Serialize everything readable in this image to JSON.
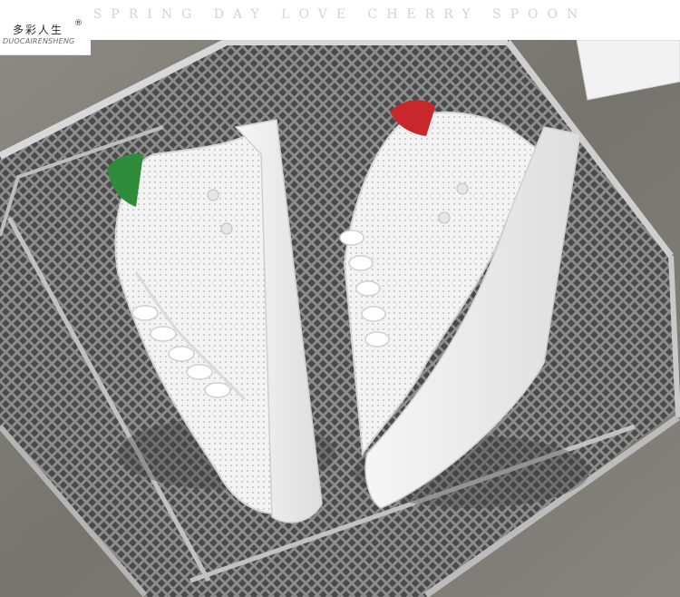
{
  "header": {
    "tagline": "SPRING DAY LOVE CHERRY SPOON"
  },
  "brand": {
    "name_cn": "多彩人生",
    "trademark": "®",
    "name_en": "DUOCAIRENSHENG"
  },
  "photo": {
    "subject": "pair of white perforated leather sneakers on a metal mesh basket",
    "heel_tab_colors": [
      "#2e8b3a",
      "#c8282c"
    ]
  }
}
